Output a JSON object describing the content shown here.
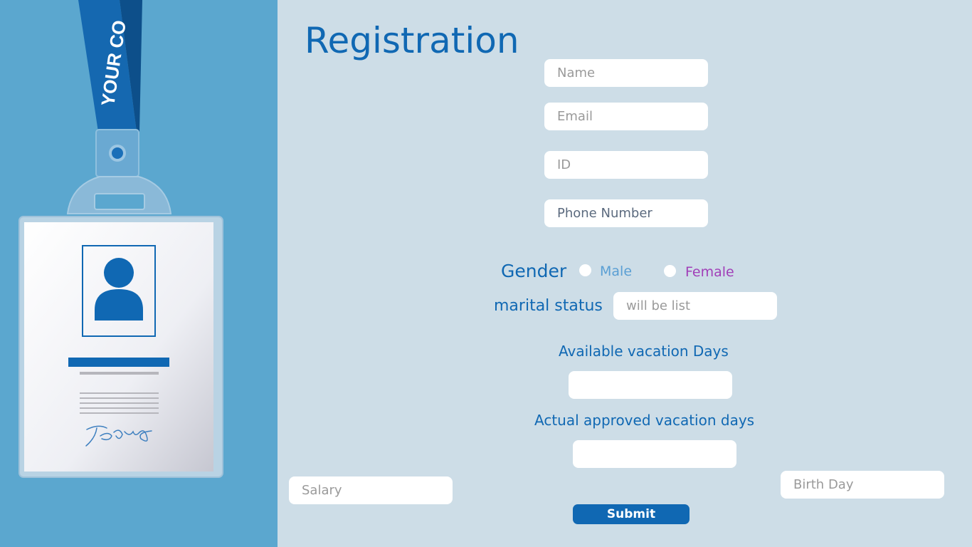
{
  "badge": {
    "lanyard_text": "YOUR CO"
  },
  "form": {
    "title": "Registration",
    "name_placeholder": "Name",
    "email_placeholder": "Email",
    "id_placeholder": "ID",
    "phone_placeholder": "Phone Number",
    "gender_label": "Gender",
    "gender_options": [
      "Male",
      "Female"
    ],
    "marital_label": "marital status",
    "marital_placeholder": "will be list",
    "available_vacation_label": "Available vacation Days",
    "approved_vacation_label": "Actual approved vacation days",
    "salary_placeholder": "Salary",
    "birthday_placeholder": "Birth Day",
    "submit_label": "Submit"
  },
  "colors": {
    "accent": "#1068b3",
    "panel": "#5ba7cf",
    "background": "#cddde7",
    "male": "#5a9fd4",
    "female": "#a13fb8"
  }
}
